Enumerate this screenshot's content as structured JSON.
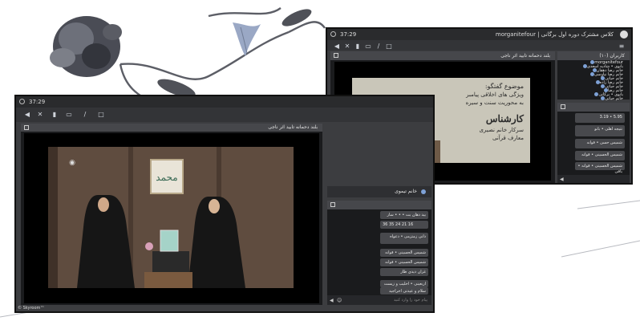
{
  "colors": {
    "window_bg": "#3c3d40",
    "titlebar": "#2a2b2d",
    "stage": "#000000",
    "chat_bubble": "#48494d",
    "accent": "#7ea1d6"
  },
  "front_window": {
    "clock": "37:29",
    "toolbar_icons": [
      "volume-icon",
      "mic-off-icon",
      "camera-icon",
      "screen-share-icon",
      "pen-icon",
      "file-icon"
    ],
    "video_panel_title": "بلند دحمانه تابید اثر ناجی",
    "footer": "© Skyroom™"
  },
  "chat_panel_front": {
    "user_bar_label": "خانم تیموی",
    "messages": [
      "بید دهان بت • • • سار",
      "36 35 24 21 16",
      "دانی زمتزمی • دعواه",
      "شمیس الحسینی • قوانه",
      "شمیس الحسینی • قوانه",
      "غزان دیدی طار",
      "اربعینی • اخلیب و زیست",
      "سلام و عیدتی اخراجید"
    ],
    "input_placeholder": "پیام خود را وارد کنید"
  },
  "back_window": {
    "clock": "37:29",
    "title": "کلاس مشترک دوره اول برگانی | morganitefour",
    "slide_panel_title": "بلند دحمانه تابید اثر ناجی",
    "slide_text_lines": [
      "موضوع گفتگو:",
      "ویژگی های اخلاقی پیامبر",
      "به محوریت سنت و سیره",
      "کارشناس",
      "سرکار خانم نصیری",
      "معارف قرآنی"
    ],
    "users_panel_title": "کاربران (۱۰)",
    "users": [
      "morganitefour",
      "بانوی • شادیه اسعدی",
      "خانم رضا دهقان",
      "خانم رضا نیاوسی",
      "خانم حیاتی",
      "خانم رضا زاده",
      "خانم حیاتی",
      "خانم رضا",
      "بانوی • برکانی",
      "خانم حیاتی"
    ],
    "chat_messages": [
      "5.95 • 3.19",
      "نتیجه اهلی • بانو",
      "شمیس حسن • قوانه",
      "شمیس الحسینی • قوانه",
      "شمیس الحسینی • قوانه • باقی"
    ]
  }
}
